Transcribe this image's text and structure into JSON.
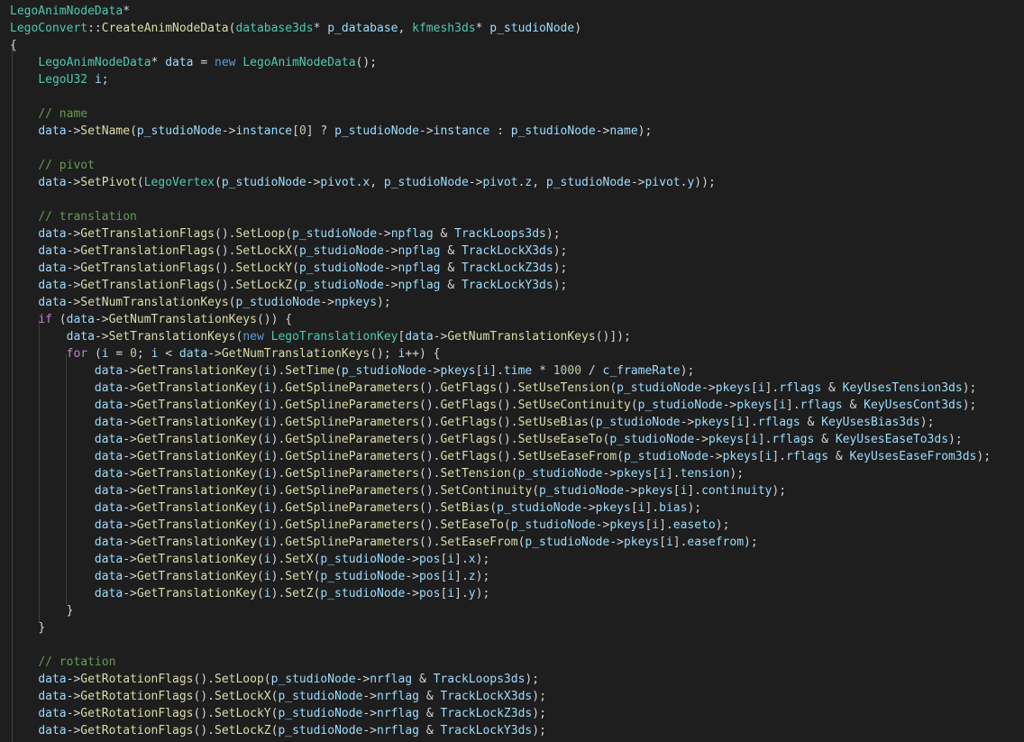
{
  "editor": {
    "language": "cpp",
    "theme": "dark",
    "colors": {
      "background": "#1e1e1e",
      "text": "#d4d4d4",
      "keyword": "#569cd6",
      "control": "#c586c0",
      "type": "#4ec9b0",
      "function": "#dcdcaa",
      "variable": "#9cdcfe",
      "comment": "#6a9955",
      "number": "#b5cea8"
    },
    "lines": [
      "LegoAnimNodeData*",
      "LegoConvert::CreateAnimNodeData(database3ds* p_database, kfmesh3ds* p_studioNode)",
      "{",
      "    LegoAnimNodeData* data = new LegoAnimNodeData();",
      "    LegoU32 i;",
      "",
      "    // name",
      "    data->SetName(p_studioNode->instance[0] ? p_studioNode->instance : p_studioNode->name);",
      "",
      "    // pivot",
      "    data->SetPivot(LegoVertex(p_studioNode->pivot.x, p_studioNode->pivot.z, p_studioNode->pivot.y));",
      "",
      "    // translation",
      "    data->GetTranslationFlags().SetLoop(p_studioNode->npflag & TrackLoops3ds);",
      "    data->GetTranslationFlags().SetLockX(p_studioNode->npflag & TrackLockX3ds);",
      "    data->GetTranslationFlags().SetLockY(p_studioNode->npflag & TrackLockZ3ds);",
      "    data->GetTranslationFlags().SetLockZ(p_studioNode->npflag & TrackLockY3ds);",
      "    data->SetNumTranslationKeys(p_studioNode->npkeys);",
      "    if (data->GetNumTranslationKeys()) {",
      "        data->SetTranslationKeys(new LegoTranslationKey[data->GetNumTranslationKeys()]);",
      "        for (i = 0; i < data->GetNumTranslationKeys(); i++) {",
      "            data->GetTranslationKey(i).SetTime(p_studioNode->pkeys[i].time * 1000 / c_frameRate);",
      "            data->GetTranslationKey(i).GetSplineParameters().GetFlags().SetUseTension(p_studioNode->pkeys[i].rflags & KeyUsesTension3ds);",
      "            data->GetTranslationKey(i).GetSplineParameters().GetFlags().SetUseContinuity(p_studioNode->pkeys[i].rflags & KeyUsesCont3ds);",
      "            data->GetTranslationKey(i).GetSplineParameters().GetFlags().SetUseBias(p_studioNode->pkeys[i].rflags & KeyUsesBias3ds);",
      "            data->GetTranslationKey(i).GetSplineParameters().GetFlags().SetUseEaseTo(p_studioNode->pkeys[i].rflags & KeyUsesEaseTo3ds);",
      "            data->GetTranslationKey(i).GetSplineParameters().GetFlags().SetUseEaseFrom(p_studioNode->pkeys[i].rflags & KeyUsesEaseFrom3ds);",
      "            data->GetTranslationKey(i).GetSplineParameters().SetTension(p_studioNode->pkeys[i].tension);",
      "            data->GetTranslationKey(i).GetSplineParameters().SetContinuity(p_studioNode->pkeys[i].continuity);",
      "            data->GetTranslationKey(i).GetSplineParameters().SetBias(p_studioNode->pkeys[i].bias);",
      "            data->GetTranslationKey(i).GetSplineParameters().SetEaseTo(p_studioNode->pkeys[i].easeto);",
      "            data->GetTranslationKey(i).GetSplineParameters().SetEaseFrom(p_studioNode->pkeys[i].easefrom);",
      "            data->GetTranslationKey(i).SetX(p_studioNode->pos[i].x);",
      "            data->GetTranslationKey(i).SetY(p_studioNode->pos[i].z);",
      "            data->GetTranslationKey(i).SetZ(p_studioNode->pos[i].y);",
      "        }",
      "    }",
      "",
      "    // rotation",
      "    data->GetRotationFlags().SetLoop(p_studioNode->nrflag & TrackLoops3ds);",
      "    data->GetRotationFlags().SetLockX(p_studioNode->nrflag & TrackLockX3ds);",
      "    data->GetRotationFlags().SetLockY(p_studioNode->nrflag & TrackLockZ3ds);",
      "    data->GetRotationFlags().SetLockZ(p_studioNode->nrflag & TrackLockY3ds);"
    ]
  }
}
